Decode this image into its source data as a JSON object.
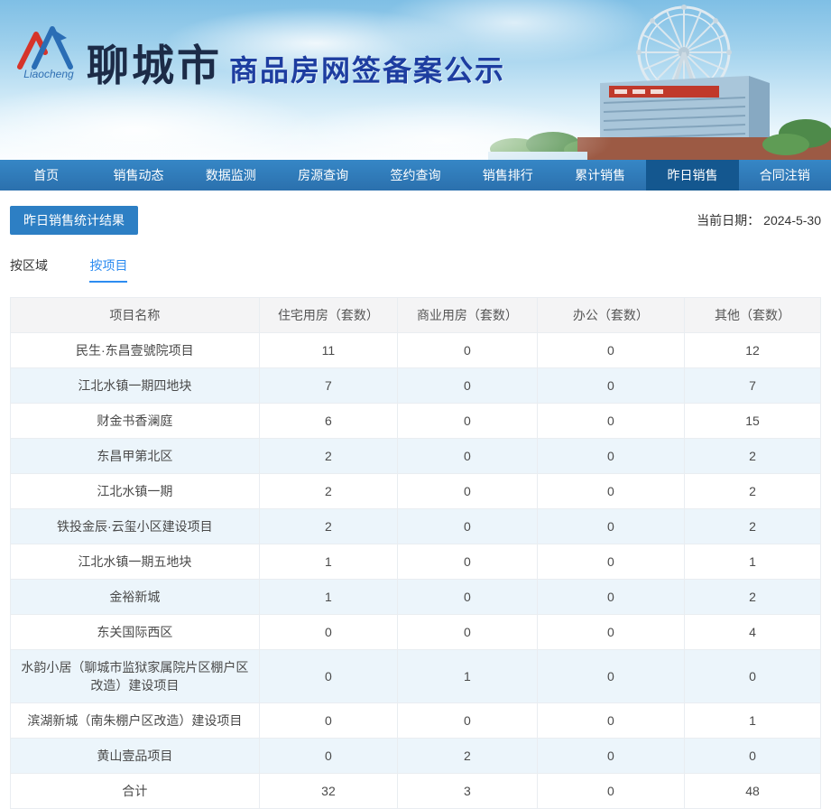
{
  "header": {
    "logo_script": "Liaocheng",
    "city_name": "聊城市",
    "site_title": "商品房网签备案公示"
  },
  "nav": {
    "items": [
      {
        "label": "首页"
      },
      {
        "label": "销售动态"
      },
      {
        "label": "数据监测"
      },
      {
        "label": "房源查询"
      },
      {
        "label": "签约查询"
      },
      {
        "label": "销售排行"
      },
      {
        "label": "累计销售"
      },
      {
        "label": "昨日销售",
        "active": true
      },
      {
        "label": "合同注销"
      }
    ]
  },
  "content": {
    "section_title": "昨日销售统计结果",
    "current_date_label": "当前日期：",
    "current_date": "2024-5-30",
    "tabs": [
      {
        "label": "按区域"
      },
      {
        "label": "按项目",
        "active": true
      }
    ]
  },
  "table": {
    "headers": [
      "项目名称",
      "住宅用房（套数）",
      "商业用房（套数）",
      "办公（套数）",
      "其他（套数）"
    ],
    "rows": [
      [
        "民生·东昌壹號院项目",
        "11",
        "0",
        "0",
        "12"
      ],
      [
        "江北水镇一期四地块",
        "7",
        "0",
        "0",
        "7"
      ],
      [
        "财金书香澜庭",
        "6",
        "0",
        "0",
        "15"
      ],
      [
        "东昌甲第北区",
        "2",
        "0",
        "0",
        "2"
      ],
      [
        "江北水镇一期",
        "2",
        "0",
        "0",
        "2"
      ],
      [
        "铁投金辰·云玺小区建设项目",
        "2",
        "0",
        "0",
        "2"
      ],
      [
        "江北水镇一期五地块",
        "1",
        "0",
        "0",
        "1"
      ],
      [
        "金裕新城",
        "1",
        "0",
        "0",
        "2"
      ],
      [
        "东关国际西区",
        "0",
        "0",
        "0",
        "4"
      ],
      [
        "水韵小居（聊城市监狱家属院片区棚户区改造）建设项目",
        "0",
        "1",
        "0",
        "0"
      ],
      [
        "滨湖新城（南朱棚户区改造）建设项目",
        "0",
        "0",
        "0",
        "1"
      ],
      [
        "黄山壹品项目",
        "0",
        "2",
        "0",
        "0"
      ],
      [
        "合计",
        "32",
        "3",
        "0",
        "48"
      ]
    ]
  },
  "colors": {
    "nav_blue": "#2f7cba",
    "nav_active_blue": "#14578f",
    "accent_badge_blue": "#2d7fc4",
    "tab_active_blue": "#2d8cf0",
    "site_title_blue": "#1d3da0",
    "row_stripe_blue": "#ecf5fb",
    "table_header_gray": "#f4f4f5"
  }
}
